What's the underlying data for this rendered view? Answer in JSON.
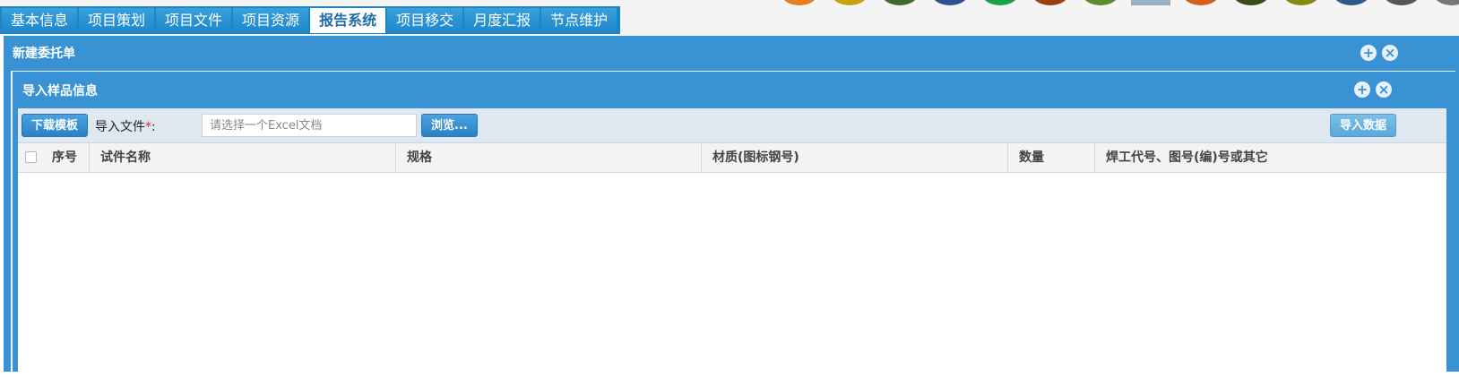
{
  "nav": {
    "tabs": [
      "基本信息",
      "项目策划",
      "项目文件",
      "项目资源",
      "报告系统",
      "项目移交",
      "月度汇报",
      "节点维护"
    ],
    "active_index": 4,
    "theme_colors": [
      "#e67e22",
      "#c9a10a",
      "#3d6b2a",
      "#2f4f8f",
      "#16a34a",
      "#9a3e0c",
      "#5d8a2e",
      "#9aaec6",
      "#d35f1a",
      "#3b4a1a",
      "#8a8a10",
      "#2c5a8c",
      "#555555",
      "#777777"
    ]
  },
  "outer_panel": {
    "title": "新建委托单",
    "icons": [
      "add-icon",
      "close-icon"
    ]
  },
  "inner_panel": {
    "title": "导入样品信息",
    "icons": [
      "add-icon",
      "close-icon"
    ]
  },
  "toolbar": {
    "download_template": "下载模板",
    "import_file_label": "导入文件",
    "required_mark": "*",
    "colon": ":",
    "file_placeholder": "请选择一个Excel文档",
    "file_value": "",
    "browse": "浏览...",
    "import_data": "导入数据"
  },
  "grid": {
    "columns": [
      "序号",
      "试件名称",
      "规格",
      "材质(图标钢号)",
      "数量",
      "焊工代号、图号(编)号或其它"
    ],
    "rows": []
  }
}
